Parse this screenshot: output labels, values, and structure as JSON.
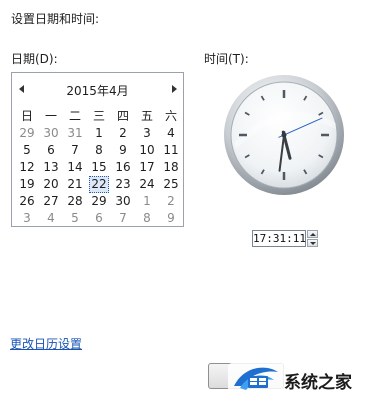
{
  "page": {
    "title": "设置日期和时间:"
  },
  "date_label": "日期(D):",
  "time_label": "时间(T):",
  "calendar": {
    "month_label": "2015年4月",
    "weekdays": [
      "日",
      "一",
      "二",
      "三",
      "四",
      "五",
      "六"
    ],
    "days": [
      {
        "d": "29",
        "dim": true
      },
      {
        "d": "30",
        "dim": true
      },
      {
        "d": "31",
        "dim": true
      },
      {
        "d": "1"
      },
      {
        "d": "2"
      },
      {
        "d": "3"
      },
      {
        "d": "4"
      },
      {
        "d": "5"
      },
      {
        "d": "6"
      },
      {
        "d": "7"
      },
      {
        "d": "8"
      },
      {
        "d": "9"
      },
      {
        "d": "10"
      },
      {
        "d": "11"
      },
      {
        "d": "12"
      },
      {
        "d": "13"
      },
      {
        "d": "14"
      },
      {
        "d": "15"
      },
      {
        "d": "16"
      },
      {
        "d": "17"
      },
      {
        "d": "18"
      },
      {
        "d": "19"
      },
      {
        "d": "20"
      },
      {
        "d": "21"
      },
      {
        "d": "22",
        "selected": true
      },
      {
        "d": "23"
      },
      {
        "d": "24"
      },
      {
        "d": "25"
      },
      {
        "d": "26"
      },
      {
        "d": "27"
      },
      {
        "d": "28"
      },
      {
        "d": "29"
      },
      {
        "d": "30"
      },
      {
        "d": "1",
        "dim": true
      },
      {
        "d": "2",
        "dim": true
      },
      {
        "d": "3",
        "dim": true
      },
      {
        "d": "4",
        "dim": true
      },
      {
        "d": "5",
        "dim": true
      },
      {
        "d": "6",
        "dim": true
      },
      {
        "d": "7",
        "dim": true
      },
      {
        "d": "8",
        "dim": true
      },
      {
        "d": "9",
        "dim": true
      }
    ]
  },
  "clock": {
    "hours": 17,
    "minutes": 31,
    "seconds": 11
  },
  "time_value": "17:31:11",
  "calendar_settings_link": "更改日历设置",
  "watermark": {
    "text": "系统之家"
  },
  "colors": {
    "link": "#1a55b5",
    "selection": "#dce8f7",
    "logo_blue": "#1f6fd1"
  }
}
